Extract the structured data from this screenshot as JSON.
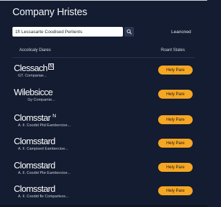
{
  "header": {
    "title": "Company Hristes",
    "search_value": "1f\\ Lessasarte Coodised Perlients",
    "launched_label": "Leancned"
  },
  "columns": {
    "left": "Accolicaly Diares",
    "right": "Roant States"
  },
  "rows": [
    {
      "name": "Clessach",
      "suffix": "N",
      "sub": "GT. Compariae...",
      "button": "Hely Pare"
    },
    {
      "name": "Wilebsicce",
      "suffix": "",
      "sub": "Gy Compamie...",
      "button": "Hely Pare"
    },
    {
      "name": "Clomsstar",
      "suffix": "N",
      "sub": "A. Il. Coodid Plid Eambercioe...",
      "button": "Hely Pare"
    },
    {
      "name": "Clomsstard",
      "suffix": "",
      "sub": "A. Il. Campised Eambercioe...",
      "button": "Hely Pare"
    },
    {
      "name": "Clomsstard",
      "suffix": "",
      "sub": "A. Il. Coodid Plie Eambercioe...",
      "button": "Hely Pare"
    },
    {
      "name": "Clomsstard",
      "suffix": "",
      "sub": "A. Il. Coodid fle Comparteze...",
      "button": "Hely Pare"
    }
  ]
}
